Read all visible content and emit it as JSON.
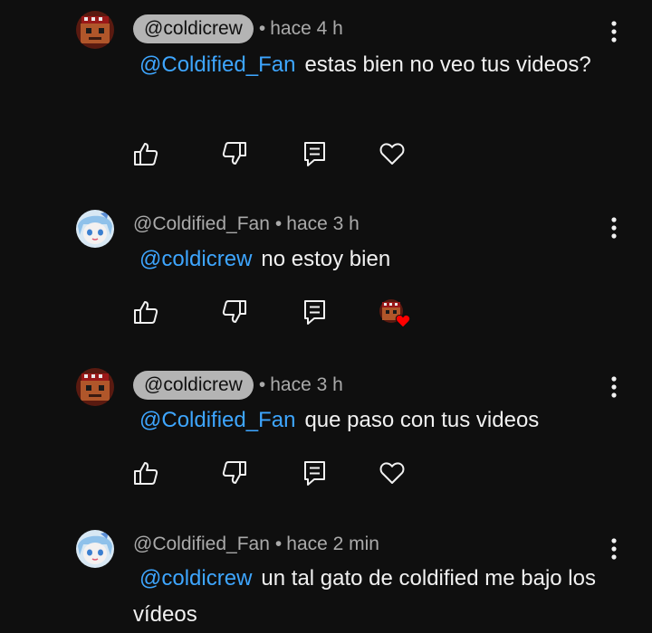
{
  "comments": [
    {
      "author": "@coldicrew",
      "author_style": "chip",
      "avatar_icon": "pixel-head-avatar",
      "separator": "•",
      "time": "hace 4 h",
      "mention": "@Coldified_Fan",
      "text": "estas bien no veo tus videos?",
      "actions": [
        "thumb-up-icon",
        "thumb-down-icon",
        "reply-icon",
        "heart-icon"
      ]
    },
    {
      "author": "@Coldified_Fan",
      "author_style": "plain",
      "avatar_icon": "anime-girl-avatar",
      "separator": "•",
      "time": "hace 3 h",
      "mention": "@coldicrew",
      "text": "no estoy bien",
      "actions": [
        "thumb-up-icon",
        "thumb-down-icon",
        "reply-icon",
        "creator-heart-icon"
      ]
    },
    {
      "author": "@coldicrew",
      "author_style": "chip",
      "avatar_icon": "pixel-head-avatar",
      "separator": "•",
      "time": "hace 3 h",
      "mention": "@Coldified_Fan",
      "text": "que paso con tus videos",
      "actions": [
        "thumb-up-icon",
        "thumb-down-icon",
        "reply-icon",
        "heart-icon"
      ]
    },
    {
      "author": "@Coldified_Fan",
      "author_style": "plain",
      "avatar_icon": "anime-girl-avatar",
      "separator": "•",
      "time": "hace 2 min",
      "mention": "@coldicrew",
      "text": "un tal gato de coldified me bajo los vídeos",
      "actions": []
    }
  ],
  "colors": {
    "background": "#0f0f0f",
    "text": "#f1f1f1",
    "secondary": "#aaaaaa",
    "mention": "#3ea6ff",
    "chip": "#b4b4b4",
    "heart_red": "#ff0000"
  }
}
